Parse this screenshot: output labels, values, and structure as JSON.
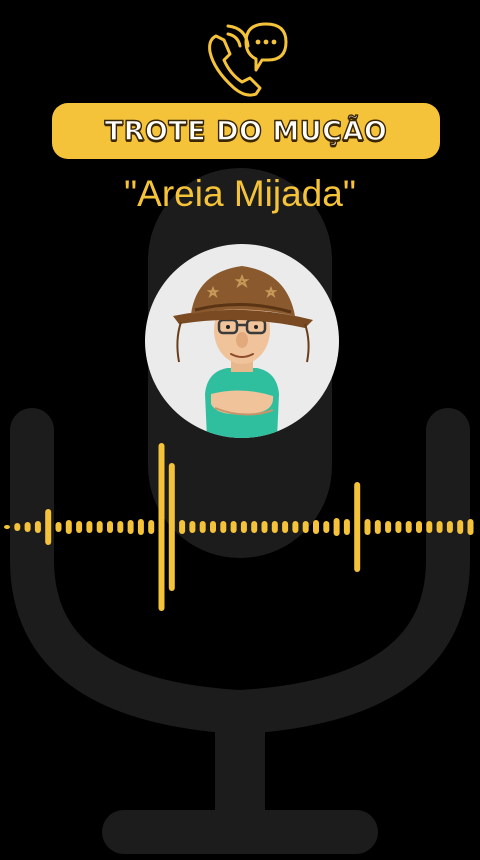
{
  "colors": {
    "accent": "#f5c33a",
    "background": "#000000",
    "mic_silhouette": "#1c1c1c"
  },
  "header": {
    "icon": "phone-call-chat-icon",
    "title": "TROTE DO MUÇÃO",
    "subtitle": "\"Areia Mijada\""
  },
  "avatar": {
    "icon": "cartoon-old-man-avatar"
  },
  "background": {
    "icon": "microphone-icon"
  },
  "waveform": {
    "icon": "audio-waveform-icon"
  }
}
